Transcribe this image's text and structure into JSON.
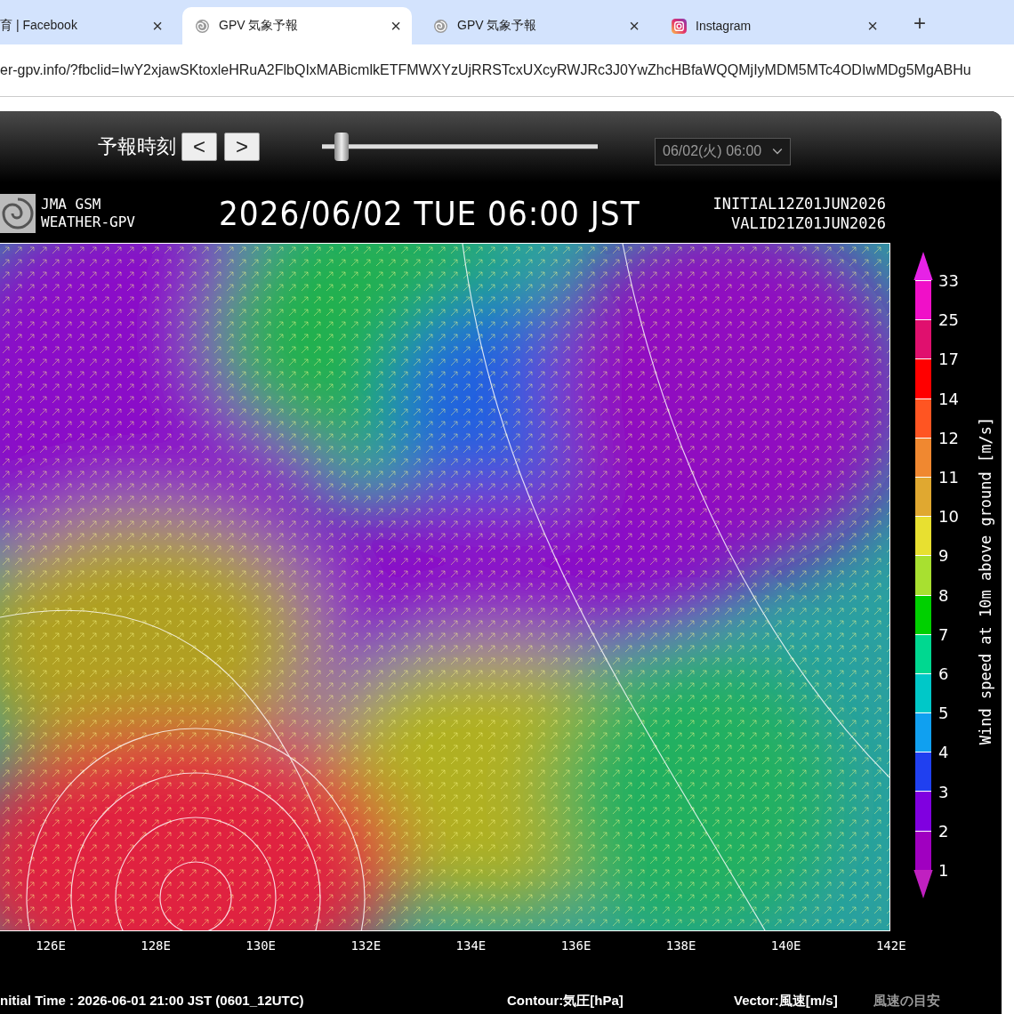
{
  "browser": {
    "tabs": [
      {
        "title": "育 | Facebook",
        "kind": "plain",
        "close": "×",
        "selected": false
      },
      {
        "title": "GPV 気象予報",
        "kind": "gpv",
        "close": "×",
        "selected": true
      },
      {
        "title": "GPV 気象予報",
        "kind": "gpv",
        "close": "×",
        "selected": false
      },
      {
        "title": "Instagram",
        "kind": "instagram",
        "close": "×",
        "selected": false
      }
    ],
    "new_tab": "+",
    "url": "er-gpv.info/?fbclid=IwY2xjawSKtoxleHRuA2FlbQIxMABicmlkETFMWXYzUjRRSTcxUXcyRWJRc3J0YwZhcHBfaWQQMjIyMDM5MTc4ODIwMDg5MgABHu"
  },
  "controls": {
    "label": "予報時刻",
    "prev": "<",
    "next": ">",
    "slider": {
      "level": 0.05
    },
    "select": {
      "value": "06/02(火) 06:00"
    }
  },
  "map": {
    "header": {
      "logo_lines": [
        "JMA GSM",
        "WEATHER-GPV"
      ],
      "datetime": "2026/06/02 TUE 06:00 JST",
      "initial": "INITIAL12Z01JUN2026",
      "valid": "VALID21Z01JUN2026"
    },
    "longitudes": [
      "126E",
      "128E",
      "130E",
      "132E",
      "134E",
      "136E",
      "138E",
      "140E",
      "142E"
    ],
    "colorbar": {
      "title": "Wind speed at 10m above ground [m/s]",
      "bands": [
        {
          "kind": "arrow_up",
          "color": "#e622e6"
        },
        {
          "color": "#f010c8"
        },
        {
          "color": "#e0106e"
        },
        {
          "color": "#ff0000"
        },
        {
          "color": "#ff5522"
        },
        {
          "color": "#f08830"
        },
        {
          "color": "#e0a830"
        },
        {
          "color": "#e8e030"
        },
        {
          "color": "#a8e030"
        },
        {
          "color": "#00d000"
        },
        {
          "color": "#00d890"
        },
        {
          "color": "#00c8c8"
        },
        {
          "color": "#10a0f0"
        },
        {
          "color": "#2040f0"
        },
        {
          "color": "#8000e0"
        },
        {
          "color": "#a000c0"
        },
        {
          "kind": "arrow_down",
          "color": "#c020c0"
        }
      ],
      "ticks": [
        "33",
        "25",
        "17",
        "14",
        "12",
        "11",
        "10",
        "9",
        "8",
        "7",
        "6",
        "5",
        "4",
        "3",
        "2",
        "1"
      ]
    }
  },
  "footer": {
    "initial_time": "nitial Time : 2026-06-01 21:00 JST (0601_12UTC)",
    "contour": "Contour:気圧[hPa]",
    "vector": "Vector:風速[m/s]",
    "guide_link": "風速の目安"
  }
}
